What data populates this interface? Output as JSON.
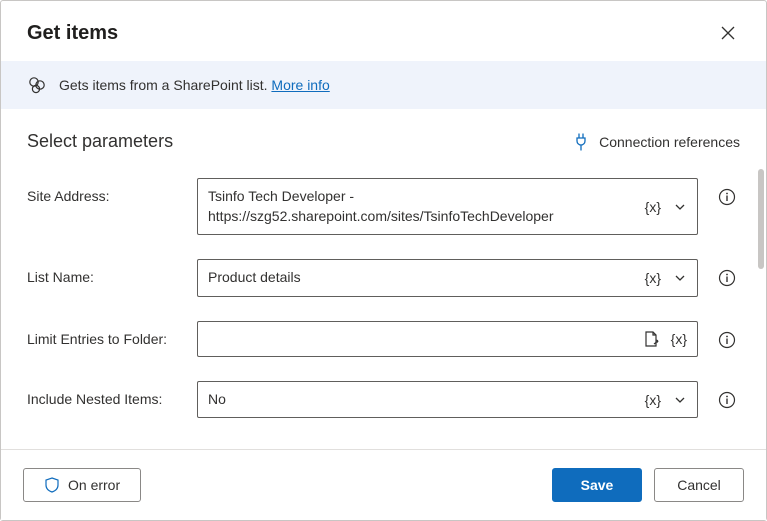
{
  "header": {
    "title": "Get items"
  },
  "banner": {
    "text": "Gets items from a SharePoint list. ",
    "link": "More info"
  },
  "section": {
    "title": "Select parameters",
    "connection_ref": "Connection references"
  },
  "params": {
    "site_address": {
      "label": "Site Address:",
      "value": "Tsinfo Tech Developer - https://szg52.sharepoint.com/sites/TsinfoTechDeveloper",
      "token": "{x}"
    },
    "list_name": {
      "label": "List Name:",
      "value": "Product details",
      "token": "{x}"
    },
    "limit_folder": {
      "label": "Limit Entries to Folder:",
      "value": "",
      "token": "{x}"
    },
    "include_nested": {
      "label": "Include Nested Items:",
      "value": "No",
      "token": "{x}"
    }
  },
  "footer": {
    "on_error": "On error",
    "save": "Save",
    "cancel": "Cancel"
  }
}
